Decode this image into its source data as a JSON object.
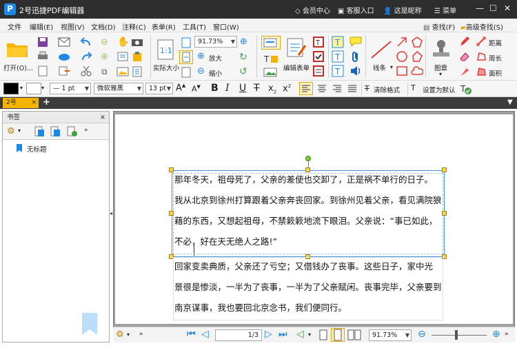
{
  "app": {
    "title": "2号迅捷PDF编辑器",
    "logo": "P"
  },
  "titlebar": {
    "member": "会员中心",
    "service": "客服入口",
    "nickname": "这是昵称",
    "menu": "菜单"
  },
  "menubar": [
    "文件",
    "编辑(E)",
    "视图(V)",
    "文档(D)",
    "注释(C)",
    "表单(R)",
    "工具(T)",
    "窗口(W)"
  ],
  "search": {
    "find": "查找(F)",
    "advanced": "高级查找(S)"
  },
  "ribbon": {
    "open": "打开(O)...",
    "actual_size": "实际大小",
    "zoom_value": "91.73%",
    "zoom_in": "放大",
    "zoom_out": "缩小",
    "edit_form": "编辑表单",
    "lines": "线条",
    "stamp": "图章",
    "distance": "距离",
    "perimeter": "周长",
    "area": "面积"
  },
  "format": {
    "line_width": "1 pt",
    "font": "微软雅黑",
    "font_size": "13 pt",
    "clear_format": "清除格式",
    "set_default": "设置为默认"
  },
  "tab": {
    "name": "2号"
  },
  "sidebar": {
    "title": "书签",
    "item": "无标题"
  },
  "document": {
    "paragraph1": [
      "那年冬天，祖母死了，父亲的差使也交卸了，正是祸不单行的日子。",
      "我从北京到徐州打算跟着父亲奔丧回家。到徐州见着父亲，看见满院狼",
      "藉的东西，又想起祖母，不禁簌簌地流下眼泪。父亲说：“事已如此，",
      "不必，好在天无绝人之路!”"
    ],
    "paragraph2": [
      "回家变卖典质，父亲还了亏空；又借钱办了丧事。这些日子，家中光",
      "景很是惨淡，一半为了丧事，一半为了父亲赋闲。丧事完毕，父亲要到",
      "南京谋事，我也要回北京念书，我们便同行。"
    ]
  },
  "statusbar": {
    "page": "1/3",
    "zoom": "91.73%"
  }
}
